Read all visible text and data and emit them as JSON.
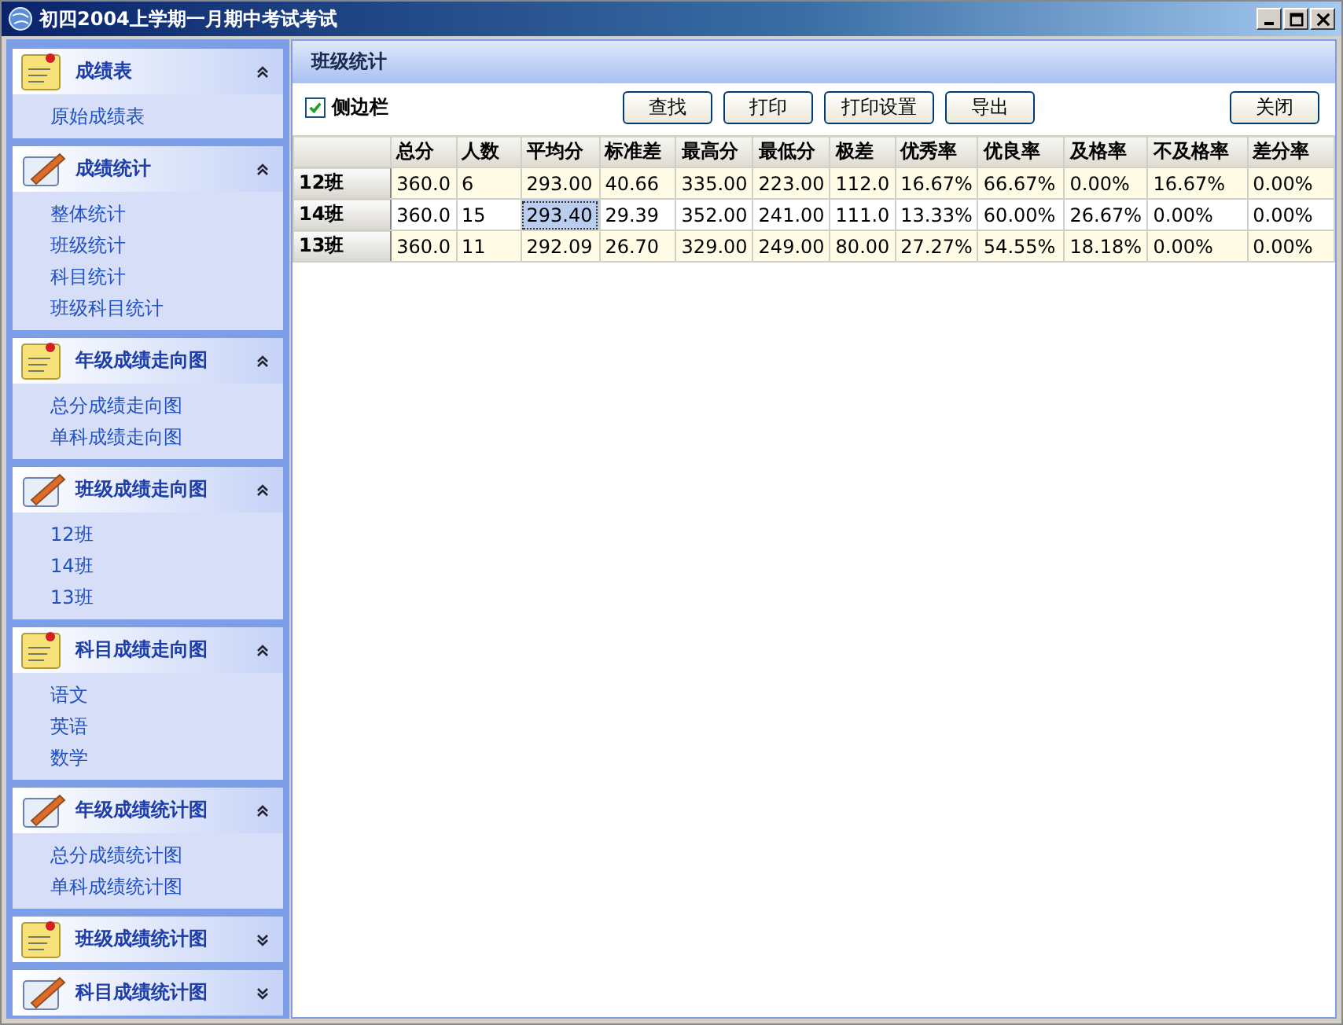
{
  "window": {
    "title": "初四2004上学期一月期中考试考试"
  },
  "sidebar": {
    "groups": [
      {
        "title": "成绩表",
        "expanded": true,
        "items": [
          "原始成绩表"
        ]
      },
      {
        "title": "成绩统计",
        "expanded": true,
        "items": [
          "整体统计",
          "班级统计",
          "科目统计",
          "班级科目统计"
        ]
      },
      {
        "title": "年级成绩走向图",
        "expanded": true,
        "items": [
          "总分成绩走向图",
          "单科成绩走向图"
        ]
      },
      {
        "title": "班级成绩走向图",
        "expanded": true,
        "items": [
          "12班",
          "14班",
          "13班"
        ]
      },
      {
        "title": "科目成绩走向图",
        "expanded": true,
        "items": [
          "语文",
          "英语",
          "数学"
        ]
      },
      {
        "title": "年级成绩统计图",
        "expanded": true,
        "items": [
          "总分成绩统计图",
          "单科成绩统计图"
        ]
      },
      {
        "title": "班级成绩统计图",
        "expanded": false
      },
      {
        "title": "科目成绩统计图",
        "expanded": false
      }
    ]
  },
  "panel": {
    "title": "班级统计"
  },
  "toolbar": {
    "sidebar_toggle": {
      "label": "侧边栏",
      "checked": true
    },
    "buttons": [
      "查找",
      "打印",
      "打印设置",
      "导出"
    ],
    "close_button": "关闭"
  },
  "table": {
    "columns": [
      "总分",
      "人数",
      "平均分",
      "标准差",
      "最高分",
      "最低分",
      "极差",
      "优秀率",
      "优良率",
      "及格率",
      "不及格率",
      "差分率"
    ],
    "rows": [
      {
        "header": "12班",
        "cells": [
          {
            "text": "360.0",
            "selected": false
          },
          {
            "text": "6",
            "selected": false
          },
          {
            "text": "293.00",
            "selected": false
          },
          {
            "text": "40.66",
            "selected": false
          },
          {
            "text": "335.00",
            "selected": false
          },
          {
            "text": "223.00",
            "selected": false
          },
          {
            "text": "112.0",
            "selected": false
          },
          {
            "text": "16.67%",
            "selected": false
          },
          {
            "text": "66.67%",
            "selected": false
          },
          {
            "text": "0.00%",
            "selected": false
          },
          {
            "text": "16.67%",
            "selected": false
          },
          {
            "text": "0.00%",
            "selected": false
          }
        ]
      },
      {
        "header": "14班",
        "cells": [
          {
            "text": "360.0",
            "selected": false
          },
          {
            "text": "15",
            "selected": false
          },
          {
            "text": "293.40",
            "selected": true
          },
          {
            "text": "29.39",
            "selected": false
          },
          {
            "text": "352.00",
            "selected": false
          },
          {
            "text": "241.00",
            "selected": false
          },
          {
            "text": "111.0",
            "selected": false
          },
          {
            "text": "13.33%",
            "selected": false
          },
          {
            "text": "60.00%",
            "selected": false
          },
          {
            "text": "26.67%",
            "selected": false
          },
          {
            "text": "0.00%",
            "selected": false
          },
          {
            "text": "0.00%",
            "selected": false
          }
        ]
      },
      {
        "header": "13班",
        "cells": [
          {
            "text": "360.0",
            "selected": false
          },
          {
            "text": "11",
            "selected": false
          },
          {
            "text": "292.09",
            "selected": false
          },
          {
            "text": "26.70",
            "selected": false
          },
          {
            "text": "329.00",
            "selected": false
          },
          {
            "text": "249.00",
            "selected": false
          },
          {
            "text": "80.00",
            "selected": false
          },
          {
            "text": "27.27%",
            "selected": false
          },
          {
            "text": "54.55%",
            "selected": false
          },
          {
            "text": "18.18%",
            "selected": false
          },
          {
            "text": "0.00%",
            "selected": false
          },
          {
            "text": "0.00%",
            "selected": false
          }
        ]
      }
    ]
  }
}
